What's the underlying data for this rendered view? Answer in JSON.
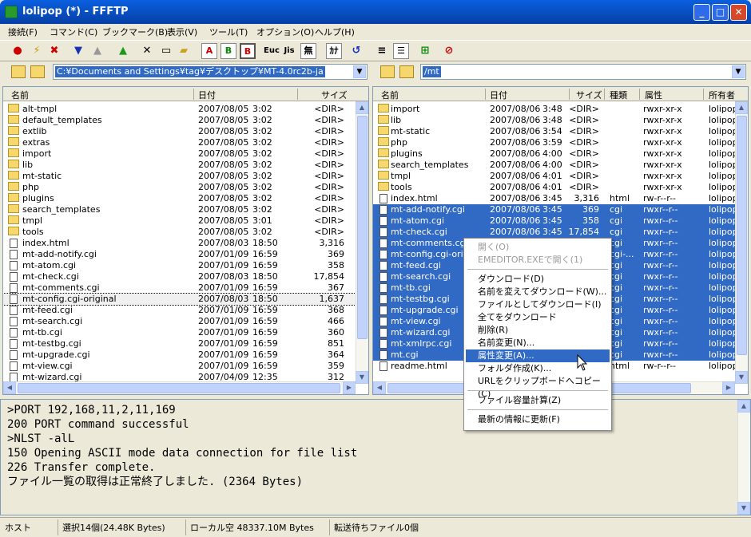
{
  "window": {
    "title": "lolipop (*) - FFFTP"
  },
  "menu": [
    "接続(F)",
    "コマンド(C)",
    "ブックマーク(B)",
    "表示(V)",
    "ツール(T)",
    "オプション(O)",
    "ヘルプ(H)"
  ],
  "toolbar": {
    "buttons": [
      "connect-icon",
      "quick-connect-icon",
      "disconnect-icon",
      "download-icon",
      "upload-icon",
      "mirror-upload-icon",
      "delete-icon",
      "rename-icon",
      "mkdir-icon",
      "ascii-mode-icon",
      "binary-mode-icon",
      "auto-mode-icon",
      "euc-icon",
      "jis-icon",
      "no-conversion-icon",
      "kana-icon",
      "refresh-icon",
      "list-view-icon",
      "detail-view-icon",
      "sync-icon",
      "stop-icon"
    ],
    "labels": {
      "ascii": "A",
      "binary": "B",
      "euc": "Euc",
      "jis": "Jis",
      "noconv": "無",
      "kana": "ｶﾅ"
    }
  },
  "local": {
    "path": "C:¥Documents and Settings¥tag¥デスクトップ¥MT-4.0rc2b-ja",
    "columns": [
      "名前",
      "日付",
      "サイズ"
    ],
    "rows": [
      {
        "name": "alt-tmpl",
        "date": "2007/08/05",
        "time": "3:02",
        "size": "<DIR>",
        "type": "folder"
      },
      {
        "name": "default_templates",
        "date": "2007/08/05",
        "time": "3:02",
        "size": "<DIR>",
        "type": "folder"
      },
      {
        "name": "extlib",
        "date": "2007/08/05",
        "time": "3:02",
        "size": "<DIR>",
        "type": "folder"
      },
      {
        "name": "extras",
        "date": "2007/08/05",
        "time": "3:02",
        "size": "<DIR>",
        "type": "folder"
      },
      {
        "name": "import",
        "date": "2007/08/05",
        "time": "3:02",
        "size": "<DIR>",
        "type": "folder"
      },
      {
        "name": "lib",
        "date": "2007/08/05",
        "time": "3:02",
        "size": "<DIR>",
        "type": "folder"
      },
      {
        "name": "mt-static",
        "date": "2007/08/05",
        "time": "3:02",
        "size": "<DIR>",
        "type": "folder"
      },
      {
        "name": "php",
        "date": "2007/08/05",
        "time": "3:02",
        "size": "<DIR>",
        "type": "folder"
      },
      {
        "name": "plugins",
        "date": "2007/08/05",
        "time": "3:02",
        "size": "<DIR>",
        "type": "folder"
      },
      {
        "name": "search_templates",
        "date": "2007/08/05",
        "time": "3:02",
        "size": "<DIR>",
        "type": "folder"
      },
      {
        "name": "tmpl",
        "date": "2007/08/05",
        "time": "3:01",
        "size": "<DIR>",
        "type": "folder"
      },
      {
        "name": "tools",
        "date": "2007/08/05",
        "time": "3:02",
        "size": "<DIR>",
        "type": "folder"
      },
      {
        "name": "index.html",
        "date": "2007/08/03",
        "time": "18:50",
        "size": "3,316",
        "type": "file"
      },
      {
        "name": "mt-add-notify.cgi",
        "date": "2007/01/09",
        "time": "16:59",
        "size": "369",
        "type": "file"
      },
      {
        "name": "mt-atom.cgi",
        "date": "2007/01/09",
        "time": "16:59",
        "size": "358",
        "type": "file"
      },
      {
        "name": "mt-check.cgi",
        "date": "2007/08/03",
        "time": "18:50",
        "size": "17,854",
        "type": "file"
      },
      {
        "name": "mt-comments.cgi",
        "date": "2007/01/09",
        "time": "16:59",
        "size": "367",
        "type": "file"
      },
      {
        "name": "mt-config.cgi-original",
        "date": "2007/08/03",
        "time": "18:50",
        "size": "1,637",
        "type": "file"
      },
      {
        "name": "mt-feed.cgi",
        "date": "2007/01/09",
        "time": "16:59",
        "size": "368",
        "type": "file"
      },
      {
        "name": "mt-search.cgi",
        "date": "2007/01/09",
        "time": "16:59",
        "size": "466",
        "type": "file"
      },
      {
        "name": "mt-tb.cgi",
        "date": "2007/01/09",
        "time": "16:59",
        "size": "360",
        "type": "file"
      },
      {
        "name": "mt-testbg.cgi",
        "date": "2007/01/09",
        "time": "16:59",
        "size": "851",
        "type": "file"
      },
      {
        "name": "mt-upgrade.cgi",
        "date": "2007/01/09",
        "time": "16:59",
        "size": "364",
        "type": "file"
      },
      {
        "name": "mt-view.cgi",
        "date": "2007/01/09",
        "time": "16:59",
        "size": "359",
        "type": "file"
      },
      {
        "name": "mt-wizard.cgi",
        "date": "2007/04/09",
        "time": "12:35",
        "size": "312",
        "type": "file"
      }
    ]
  },
  "remote": {
    "path": "/mt",
    "columns": [
      "名前",
      "日付",
      "サイズ",
      "種類",
      "属性",
      "所有者"
    ],
    "rows": [
      {
        "name": "import",
        "date": "2007/08/06",
        "time": "3:48",
        "size": "<DIR>",
        "kind": "",
        "attr": "rwxr-xr-x",
        "owner": "lolipop",
        "type": "folder",
        "sel": false
      },
      {
        "name": "lib",
        "date": "2007/08/06",
        "time": "3:48",
        "size": "<DIR>",
        "kind": "",
        "attr": "rwxr-xr-x",
        "owner": "lolipop",
        "type": "folder",
        "sel": false
      },
      {
        "name": "mt-static",
        "date": "2007/08/06",
        "time": "3:54",
        "size": "<DIR>",
        "kind": "",
        "attr": "rwxr-xr-x",
        "owner": "lolipop",
        "type": "folder",
        "sel": false
      },
      {
        "name": "php",
        "date": "2007/08/06",
        "time": "3:59",
        "size": "<DIR>",
        "kind": "",
        "attr": "rwxr-xr-x",
        "owner": "lolipop",
        "type": "folder",
        "sel": false
      },
      {
        "name": "plugins",
        "date": "2007/08/06",
        "time": "4:00",
        "size": "<DIR>",
        "kind": "",
        "attr": "rwxr-xr-x",
        "owner": "lolipop",
        "type": "folder",
        "sel": false
      },
      {
        "name": "search_templates",
        "date": "2007/08/06",
        "time": "4:00",
        "size": "<DIR>",
        "kind": "",
        "attr": "rwxr-xr-x",
        "owner": "lolipop",
        "type": "folder",
        "sel": false
      },
      {
        "name": "tmpl",
        "date": "2007/08/06",
        "time": "4:01",
        "size": "<DIR>",
        "kind": "",
        "attr": "rwxr-xr-x",
        "owner": "lolipop",
        "type": "folder",
        "sel": false
      },
      {
        "name": "tools",
        "date": "2007/08/06",
        "time": "4:01",
        "size": "<DIR>",
        "kind": "",
        "attr": "rwxr-xr-x",
        "owner": "lolipop",
        "type": "folder",
        "sel": false
      },
      {
        "name": "index.html",
        "date": "2007/08/06",
        "time": "3:45",
        "size": "3,316",
        "kind": "html",
        "attr": "rw-r--r--",
        "owner": "lolipop",
        "type": "file",
        "sel": false
      },
      {
        "name": "mt-add-notify.cgi",
        "date": "2007/08/06",
        "time": "3:45",
        "size": "369",
        "kind": "cgi",
        "attr": "rwxr--r--",
        "owner": "lolipop",
        "type": "file",
        "sel": true
      },
      {
        "name": "mt-atom.cgi",
        "date": "2007/08/06",
        "time": "3:45",
        "size": "358",
        "kind": "cgi",
        "attr": "rwxr--r--",
        "owner": "lolipop",
        "type": "file",
        "sel": true
      },
      {
        "name": "mt-check.cgi",
        "date": "2007/08/06",
        "time": "3:45",
        "size": "17,854",
        "kind": "cgi",
        "attr": "rwxr--r--",
        "owner": "lolipop",
        "type": "file",
        "sel": true
      },
      {
        "name": "mt-comments.cgi",
        "date": "",
        "time": "",
        "size": "",
        "kind": "cgi",
        "attr": "rwxr--r--",
        "owner": "lolipop",
        "type": "file",
        "sel": true
      },
      {
        "name": "mt-config.cgi-orig",
        "date": "",
        "time": "",
        "size": "",
        "kind": "cgi-...",
        "attr": "rwxr--r--",
        "owner": "lolipop",
        "type": "file",
        "sel": true
      },
      {
        "name": "mt-feed.cgi",
        "date": "",
        "time": "",
        "size": "",
        "kind": "cgi",
        "attr": "rwxr--r--",
        "owner": "lolipop",
        "type": "file",
        "sel": true
      },
      {
        "name": "mt-search.cgi",
        "date": "",
        "time": "",
        "size": "",
        "kind": "cgi",
        "attr": "rwxr--r--",
        "owner": "lolipop",
        "type": "file",
        "sel": true
      },
      {
        "name": "mt-tb.cgi",
        "date": "",
        "time": "",
        "size": "",
        "kind": "cgi",
        "attr": "rwxr--r--",
        "owner": "lolipop",
        "type": "file",
        "sel": true
      },
      {
        "name": "mt-testbg.cgi",
        "date": "",
        "time": "",
        "size": "",
        "kind": "cgi",
        "attr": "rwxr--r--",
        "owner": "lolipop",
        "type": "file",
        "sel": true
      },
      {
        "name": "mt-upgrade.cgi",
        "date": "",
        "time": "",
        "size": "",
        "kind": "cgi",
        "attr": "rwxr--r--",
        "owner": "lolipop",
        "type": "file",
        "sel": true
      },
      {
        "name": "mt-view.cgi",
        "date": "",
        "time": "",
        "size": "",
        "kind": "cgi",
        "attr": "rwxr--r--",
        "owner": "lolipop",
        "type": "file",
        "sel": true
      },
      {
        "name": "mt-wizard.cgi",
        "date": "",
        "time": "",
        "size": "",
        "kind": "cgi",
        "attr": "rwxr--r--",
        "owner": "lolipop",
        "type": "file",
        "sel": true
      },
      {
        "name": "mt-xmlrpc.cgi",
        "date": "",
        "time": "",
        "size": "",
        "kind": "cgi",
        "attr": "rwxr--r--",
        "owner": "lolipop",
        "type": "file",
        "sel": true
      },
      {
        "name": "mt.cgi",
        "date": "",
        "time": "",
        "size": "",
        "kind": "cgi",
        "attr": "rwxr--r--",
        "owner": "lolipop",
        "type": "file",
        "sel": true
      },
      {
        "name": "readme.html",
        "date": "",
        "time": "",
        "size": "",
        "kind": "html",
        "attr": "rw-r--r--",
        "owner": "lolipop",
        "type": "file",
        "sel": false
      }
    ]
  },
  "context_menu": [
    {
      "label": "開く(O)",
      "disabled": true
    },
    {
      "label": "EMEDITOR.EXEで開く(1)",
      "disabled": true
    },
    {
      "sep": true
    },
    {
      "label": "ダウンロード(D)"
    },
    {
      "label": "名前を変えてダウンロード(W)..."
    },
    {
      "label": "ファイルとしてダウンロード(I)"
    },
    {
      "label": "全てをダウンロード"
    },
    {
      "label": "削除(R)"
    },
    {
      "label": "名前変更(N)..."
    },
    {
      "label": "属性変更(A)...",
      "highlight": true
    },
    {
      "label": "フォルダ作成(K)..."
    },
    {
      "label": "URLをクリップボードへコピー(C)"
    },
    {
      "sep": true
    },
    {
      "label": "ファイル容量計算(Z)"
    },
    {
      "sep": true
    },
    {
      "label": "最新の情報に更新(F)"
    }
  ],
  "log": [
    ">PORT 192,168,11,2,11,169",
    "200 PORT command successful",
    ">NLST -alL",
    "150 Opening ASCII mode data connection for file list",
    "226 Transfer complete.",
    "ファイル一覧の取得は正常終了しました. (2364 Bytes)"
  ],
  "status": {
    "host": "ホスト",
    "selection": "選択14個(24.48K Bytes)",
    "local_free": "ローカル空 48337.10M Bytes",
    "queue": "転送待ちファイル0個"
  },
  "colors": {
    "title": "#0853c7",
    "select": "#316ac5"
  }
}
